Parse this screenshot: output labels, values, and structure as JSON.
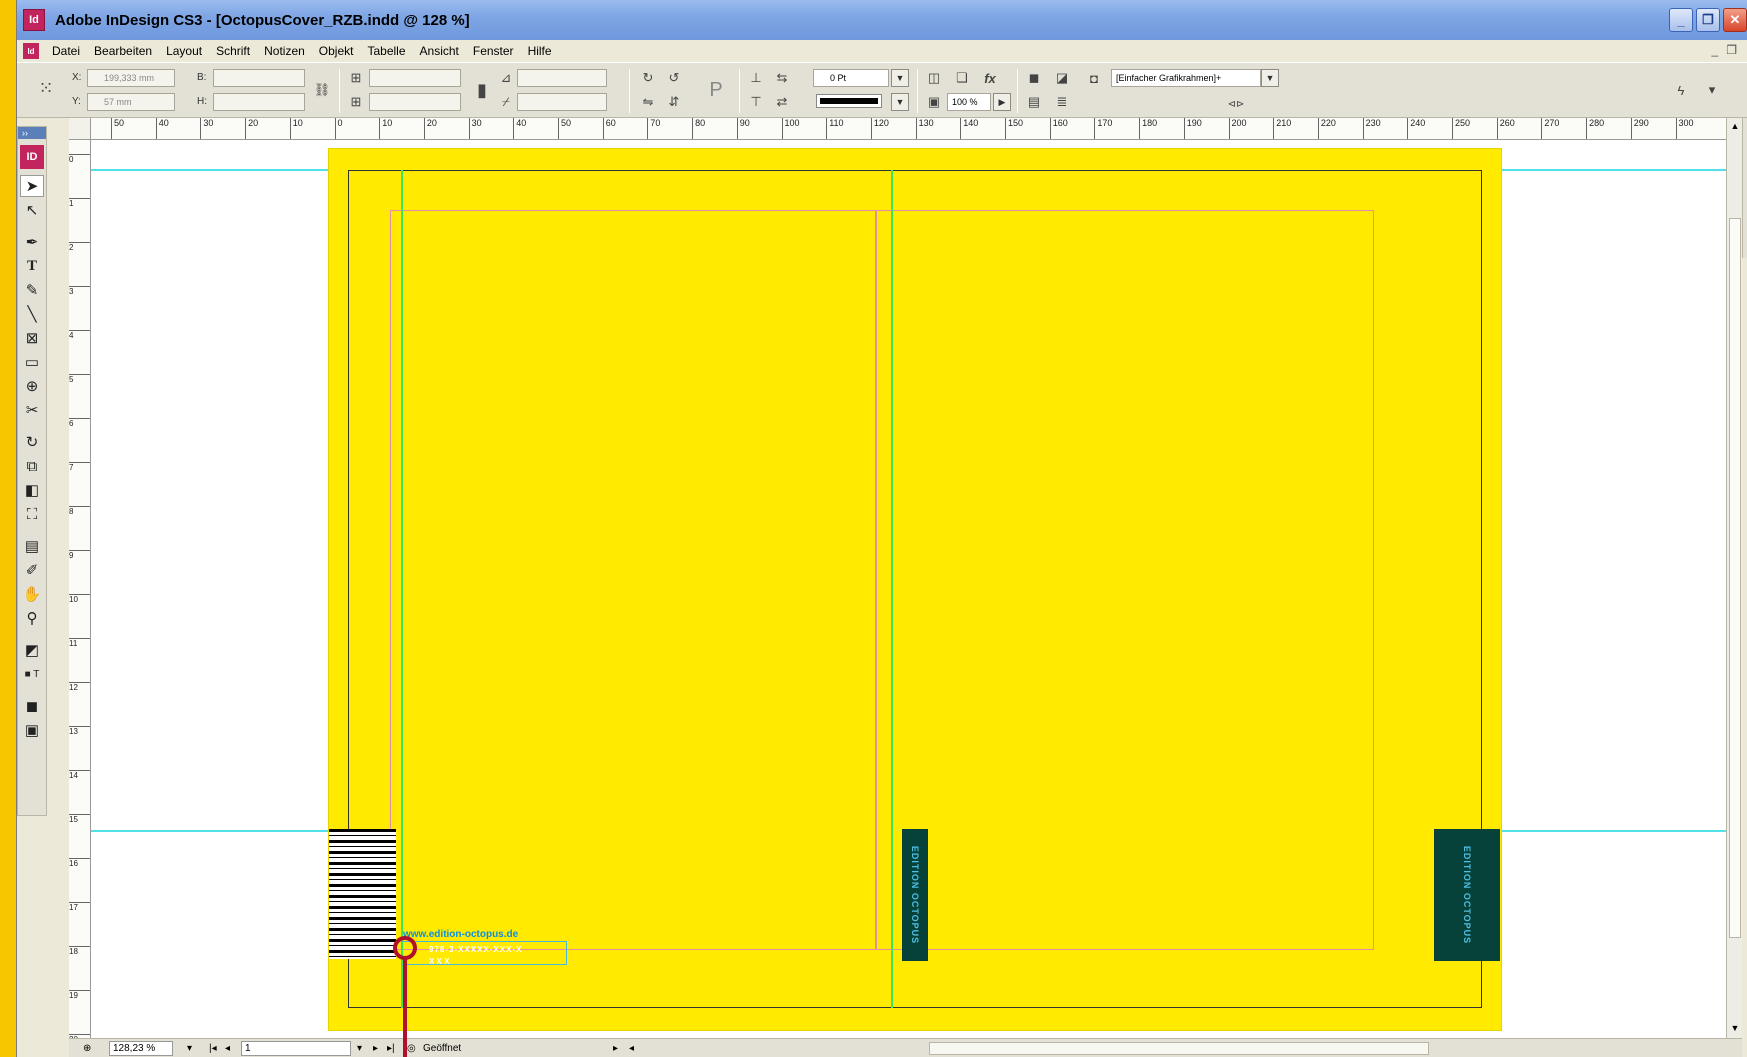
{
  "window": {
    "title": "Adobe InDesign CS3 - [OctopusCover_RZB.indd @ 128 %]",
    "app_icon": "Id",
    "buttons": [
      "minimize",
      "restore",
      "close"
    ]
  },
  "menubar": {
    "items": [
      "Datei",
      "Bearbeiten",
      "Layout",
      "Schrift",
      "Notizen",
      "Objekt",
      "Tabelle",
      "Ansicht",
      "Fenster",
      "Hilfe"
    ]
  },
  "control_panel": {
    "x_label": "X:",
    "x_value": "199,333 mm",
    "y_label": "Y:",
    "y_value": "57 mm",
    "w_label": "B:",
    "h_label": "H:",
    "stroke_weight": "0 Pt",
    "opacity": "100 %",
    "object_style": "[Einfacher Grafikrahmen]+"
  },
  "ruler": {
    "h_labels": [
      "50",
      "40",
      "30",
      "20",
      "10",
      "0",
      "10",
      "20",
      "30",
      "40",
      "50",
      "60",
      "70",
      "80",
      "90",
      "100",
      "110",
      "120",
      "130",
      "140",
      "150",
      "160",
      "170",
      "180",
      "190",
      "200",
      "210",
      "220",
      "230",
      "240",
      "250",
      "260",
      "270",
      "280",
      "290",
      "300"
    ],
    "v_labels": [
      "0",
      "1",
      "2",
      "3",
      "4",
      "5",
      "6",
      "7",
      "8",
      "9",
      "10",
      "11",
      "12",
      "13",
      "14",
      "15",
      "16",
      "17",
      "18",
      "19",
      "20"
    ]
  },
  "tools": {
    "logo": "ID",
    "icons": [
      "selection-tool-icon",
      "direct-selection-tool-icon",
      "pen-tool-icon",
      "type-tool-icon",
      "pencil-tool-icon",
      "line-tool-icon",
      "rectangle-frame-tool-icon",
      "rectangle-tool-icon",
      "button-tool-icon",
      "scissors-tool-icon",
      "rotate-tool-icon",
      "scale-tool-icon",
      "gradient-tool-icon",
      "free-transform-tool-icon",
      "note-tool-icon",
      "eyedropper-tool-icon",
      "hand-tool-icon",
      "zoom-tool-icon",
      "fill-stroke-swatch-icon",
      "apply-color-icon",
      "normal-view-icon",
      "preview-mode-icon"
    ]
  },
  "document": {
    "url_text": "www.edition-octopus.de",
    "isbn_line1": "978-3-XXXXX-XXX-X",
    "isbn_line2": "X X X",
    "spine_label": "EDITION OCTOPUS",
    "back_label": "EDITION OCTOPUS",
    "page_color": "#ffea00"
  },
  "statusbar": {
    "zoom": "128,23 %",
    "page": "1",
    "status": "Geöffnet"
  },
  "colors": {
    "background": "#f7c600",
    "guide_cyan": "#4fe0e8",
    "guide_green": "#3ee55a",
    "margin_pink": "#e98aa8",
    "marker": "#b0102a"
  }
}
